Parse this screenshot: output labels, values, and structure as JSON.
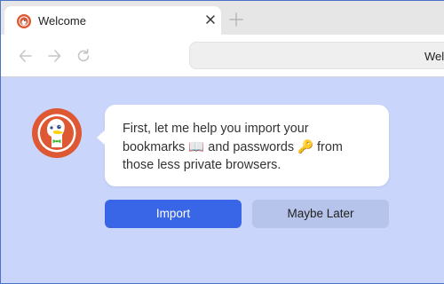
{
  "window": {
    "colors": {
      "frame_border": "#4b74c9",
      "tab_strip": "#e6e6e6",
      "content_bg": "#c9d5fb"
    }
  },
  "tabs": [
    {
      "title": "Welcome",
      "favicon": "duckduckgo-logo-icon",
      "active": true
    }
  ],
  "tab_controls": {
    "close_icon": "close-icon",
    "new_tab_icon": "plus-icon"
  },
  "navbar": {
    "back_icon": "arrow-left-icon",
    "forward_icon": "arrow-right-icon",
    "reload_icon": "reload-icon",
    "address_text": "Wel"
  },
  "onboarding": {
    "logo": "duckduckgo-logo-icon",
    "message_line1": "First, let me help you import your",
    "message_line2a": "bookmarks ",
    "bookmark_emoji": "📖",
    "message_line2b": " and passwords ",
    "key_emoji": "🔑",
    "message_line2c": " from",
    "message_line3": "those less private browsers.",
    "import_label": "Import",
    "later_label": "Maybe Later",
    "colors": {
      "import_bg": "#3966e6",
      "later_bg": "#b6c3ea",
      "brand_orange": "#de5833"
    }
  }
}
